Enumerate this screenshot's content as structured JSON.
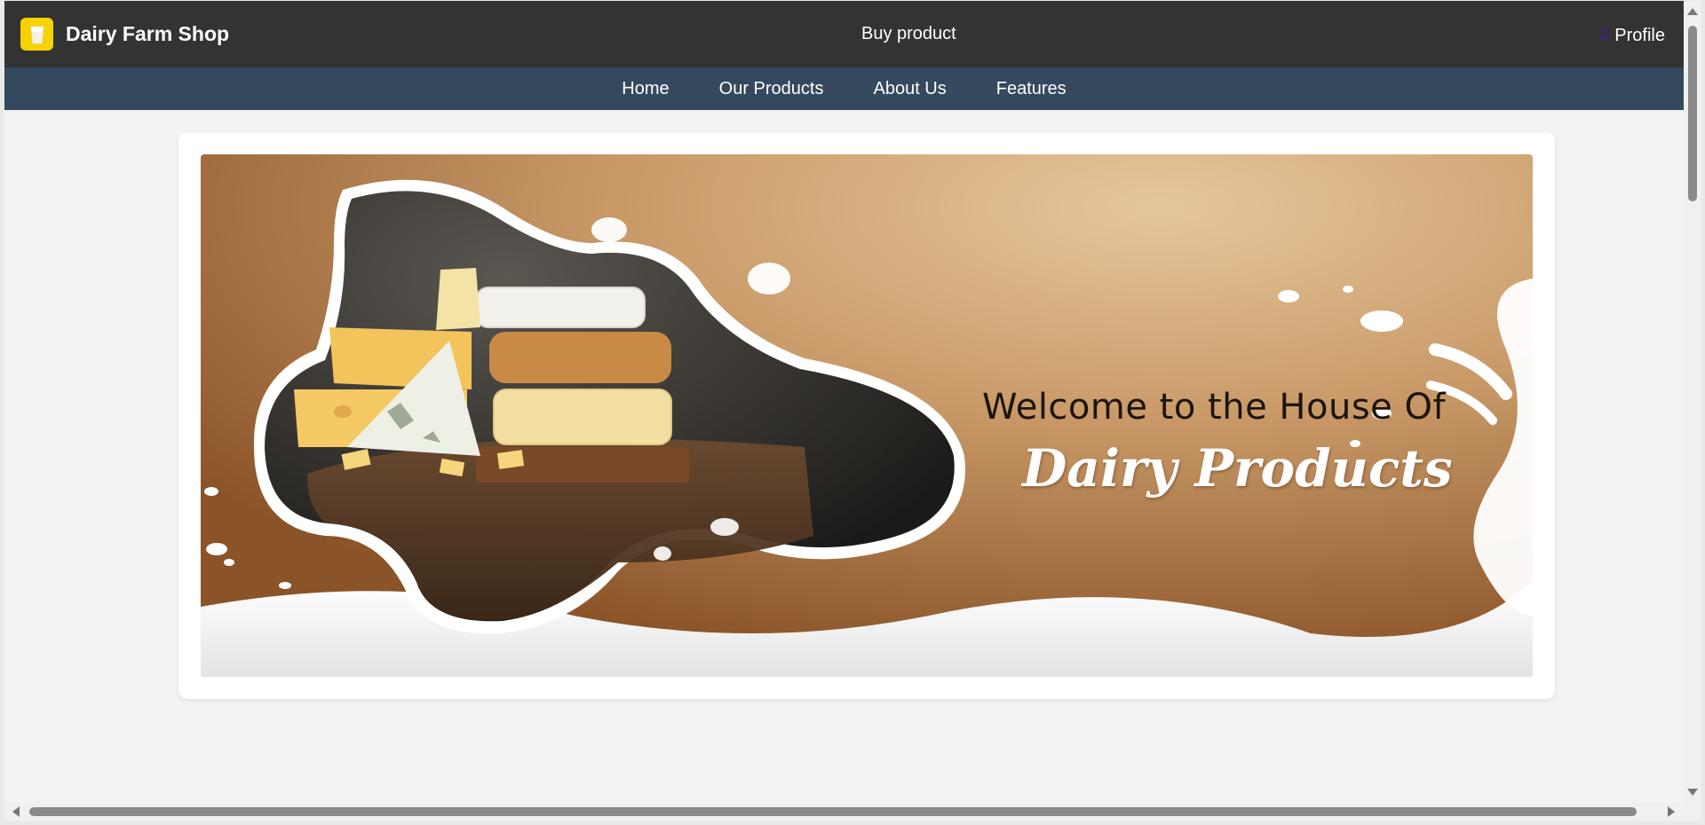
{
  "header": {
    "brand_title": "Dairy Farm Shop",
    "logo_icon": "milk-glass-icon",
    "center_text": "Buy product",
    "profile_label": "Profile",
    "profile_icon": "person-icon"
  },
  "nav": {
    "items": [
      {
        "label": "Home"
      },
      {
        "label": "Our Products"
      },
      {
        "label": "About Us"
      },
      {
        "label": "Features"
      }
    ]
  },
  "banner": {
    "welcome_line": "Welcome to the House Of",
    "headline": "Dairy Products"
  },
  "colors": {
    "topbar": "#333333",
    "navbar": "#34495e",
    "logo_bg": "#f5d200",
    "page_bg": "#f3f3f3"
  }
}
